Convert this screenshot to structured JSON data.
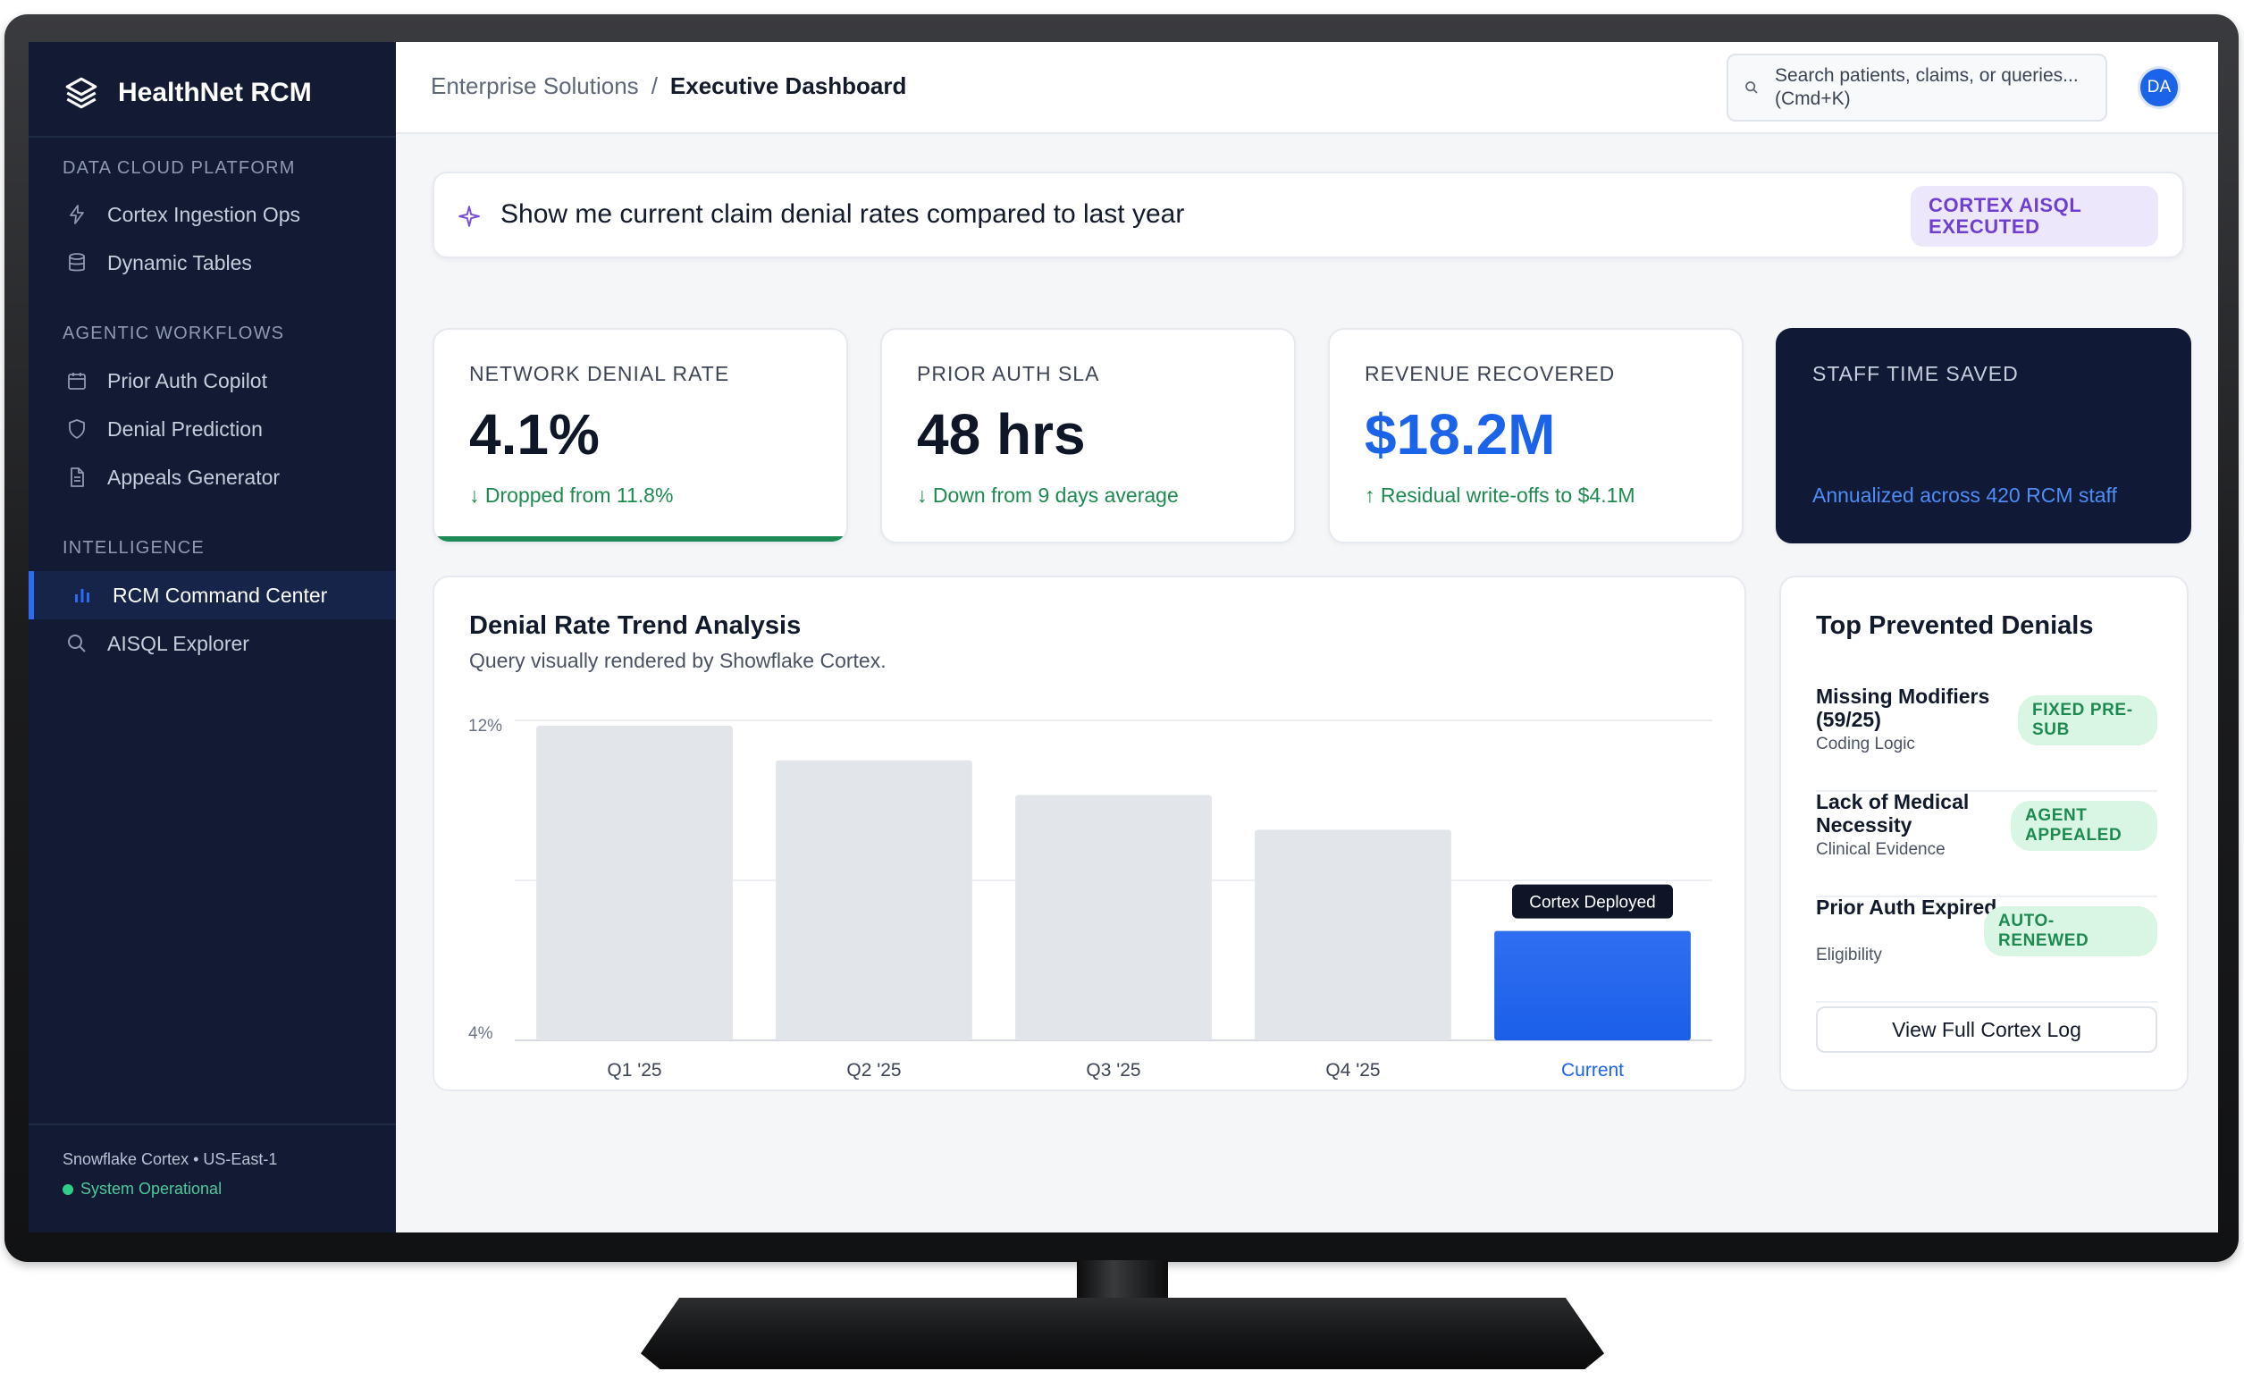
{
  "brand": {
    "name": "HealthNet RCM"
  },
  "sidebar": {
    "sections": [
      {
        "heading": "DATA CLOUD PLATFORM",
        "items": [
          {
            "label": "Cortex Ingestion Ops",
            "icon": "bolt-icon"
          },
          {
            "label": "Dynamic Tables",
            "icon": "database-icon"
          }
        ]
      },
      {
        "heading": "AGENTIC WORKFLOWS",
        "items": [
          {
            "label": "Prior Auth Copilot",
            "icon": "calendar-icon"
          },
          {
            "label": "Denial Prediction",
            "icon": "shield-icon"
          },
          {
            "label": "Appeals Generator",
            "icon": "document-icon"
          }
        ]
      },
      {
        "heading": "INTELLIGENCE",
        "items": [
          {
            "label": "RCM Command Center",
            "icon": "bar-chart-icon",
            "active": true
          },
          {
            "label": "AISQL Explorer",
            "icon": "search-icon"
          }
        ]
      }
    ],
    "footer": {
      "platform": "Snowflake Cortex • US-East-1",
      "status": "System Operational"
    }
  },
  "header": {
    "breadcrumb_parent": "Enterprise Solutions",
    "breadcrumb_sep": "/",
    "breadcrumb_current": "Executive Dashboard",
    "search_placeholder": "Search patients, claims, or queries... (Cmd+K)",
    "avatar_initials": "DA"
  },
  "prompt": {
    "text": "Show me current claim denial rates compared to last year",
    "badge": "CORTEX AISQL EXECUTED"
  },
  "metrics": [
    {
      "label": "NETWORK DENIAL RATE",
      "value": "4.1%",
      "sub": "↓ Dropped from 11.8%"
    },
    {
      "label": "PRIOR AUTH SLA",
      "value": "48 hrs",
      "sub": "↓ Down from 9 days average"
    },
    {
      "label": "REVENUE RECOVERED",
      "value": "$18.2M",
      "sub": "↑ Residual write-offs to $4.1M"
    },
    {
      "label": "STAFF TIME SAVED",
      "value": "",
      "sub": "Annualized across 420 RCM staff"
    }
  ],
  "colors": {
    "accent": "#1b63e8",
    "success": "#1d8a4f",
    "sidebar": "#121b33",
    "dark_card": "#101a36",
    "bar_grey": "#e2e5ea"
  },
  "chart_panel": {
    "title": "Denial Rate Trend Analysis",
    "subtitle": "Query visually rendered by Showflake Cortex."
  },
  "chart_data": {
    "type": "bar",
    "categories": [
      "Q1 '25",
      "Q2 '25",
      "Q3 '25",
      "Q4 '25",
      "Current"
    ],
    "values": [
      11.8,
      10.5,
      9.2,
      7.9,
      4.1
    ],
    "ylim": [
      0,
      12
    ],
    "yticks": [
      "12%",
      "4%"
    ],
    "annotation": "Cortex Deployed",
    "highlight_index": 4
  },
  "denials": {
    "title": "Top Prevented Denials",
    "items": [
      {
        "name": "Missing Modifiers (59/25)",
        "category": "Coding Logic",
        "badge": "FIXED PRE-SUB"
      },
      {
        "name": "Lack of Medical Necessity",
        "category": "Clinical Evidence",
        "badge": "AGENT APPEALED"
      },
      {
        "name": "Prior Auth Expired",
        "category": "Eligibility",
        "badge": "AUTO-RENEWED"
      }
    ],
    "view_log": "View Full Cortex Log"
  }
}
